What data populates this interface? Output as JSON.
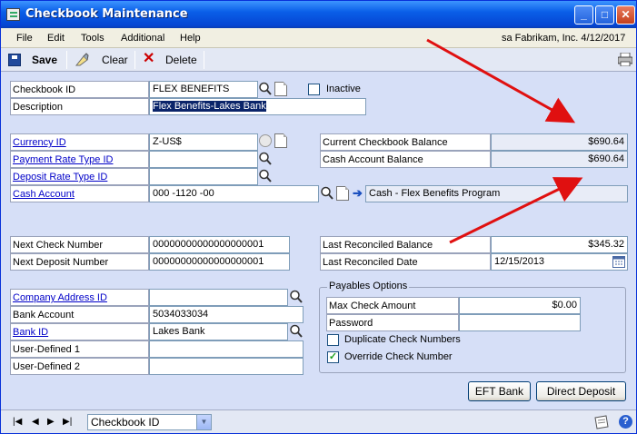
{
  "window": {
    "title": "Checkbook Maintenance"
  },
  "menu": {
    "items": [
      "File",
      "Edit",
      "Tools",
      "Additional",
      "Help"
    ],
    "company": "sa  Fabrikam, Inc.  4/12/2017"
  },
  "toolbar": {
    "save": "Save",
    "clear": "Clear",
    "delete": "Delete"
  },
  "form": {
    "checkbook_id_label": "Checkbook ID",
    "checkbook_id": "FLEX BENEFITS",
    "inactive_label": "Inactive",
    "inactive_checked": false,
    "description_label": "Description",
    "description": "Flex Benefits-Lakes Bank",
    "currency_id_label": "Currency ID",
    "currency_id": "Z-US$",
    "payment_rate_label": "Payment Rate Type ID",
    "payment_rate": "",
    "deposit_rate_label": "Deposit Rate Type ID",
    "deposit_rate": "",
    "cash_account_label": "Cash Account",
    "cash_account": "000 -1120 -00",
    "cash_account_desc": "Cash - Flex Benefits Program",
    "current_balance_label": "Current Checkbook Balance",
    "current_balance": "$690.64",
    "cash_account_balance_label": "Cash Account Balance",
    "cash_account_balance": "$690.64",
    "next_check_label": "Next Check Number",
    "next_check": "00000000000000000001",
    "next_deposit_label": "Next Deposit Number",
    "next_deposit": "00000000000000000001",
    "last_rec_balance_label": "Last Reconciled Balance",
    "last_rec_balance": "$345.32",
    "last_rec_date_label": "Last Reconciled Date",
    "last_rec_date": "12/15/2013",
    "company_address_label": "Company Address ID",
    "company_address": "",
    "bank_account_label": "Bank Account",
    "bank_account": "5034033034",
    "bank_id_label": "Bank ID",
    "bank_id": "Lakes Bank",
    "user_defined_1_label": "User-Defined 1",
    "user_defined_1": "",
    "user_defined_2_label": "User-Defined 2",
    "user_defined_2": ""
  },
  "payables": {
    "title": "Payables Options",
    "max_check_label": "Max Check Amount",
    "max_check": "$0.00",
    "password_label": "Password",
    "password": "",
    "duplicate_label": "Duplicate Check Numbers",
    "duplicate_checked": false,
    "override_label": "Override Check Number",
    "override_checked": true
  },
  "buttons": {
    "eft_bank": "EFT Bank",
    "direct_deposit": "Direct Deposit"
  },
  "statusbar": {
    "sort_by": "Checkbook ID"
  },
  "colors": {
    "title_bar": "#0545d3",
    "form_bg": "#d6dff7",
    "link": "#0000c8",
    "annotation_arrow": "#e01010"
  }
}
